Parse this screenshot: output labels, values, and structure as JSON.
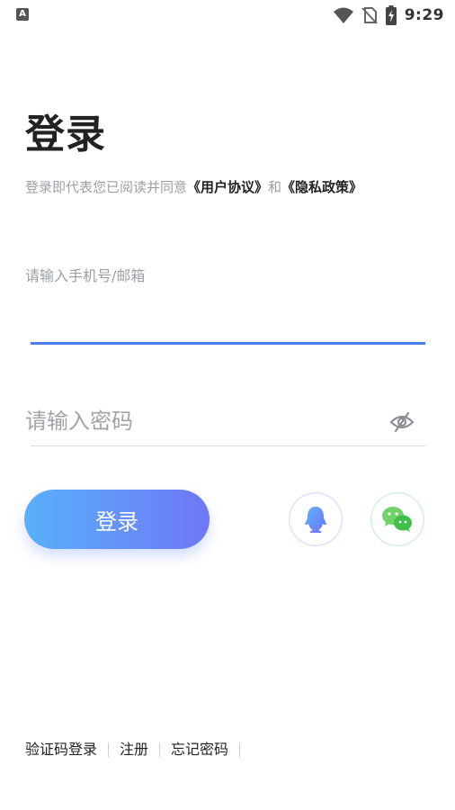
{
  "status_bar": {
    "left_icon_letter": "A",
    "time": "9:29",
    "icons": [
      "wifi-icon",
      "no-sim-icon",
      "battery-charging-icon"
    ]
  },
  "title": "登录",
  "agreement": {
    "prefix": "登录即代表您已阅读并同意",
    "user_agreement": "《用户协议》",
    "conjunction": "和",
    "privacy_policy": "《隐私政策》"
  },
  "phone": {
    "label": "请输入手机号/邮箱",
    "value": ""
  },
  "password": {
    "placeholder": "请输入密码",
    "value": "",
    "toggle_icon": "eye-hidden-icon"
  },
  "login_button": {
    "label": "登录"
  },
  "social": {
    "qq_icon": "qq-icon",
    "wechat_icon": "wechat-icon"
  },
  "bottom_links": {
    "sms_login": "验证码登录",
    "register": "注册",
    "forgot_password": "忘记密码"
  },
  "colors": {
    "accent": "#4a7ee8",
    "button_start": "#58b0fb",
    "button_end": "#6f77f6",
    "muted_text": "#9aa0a6"
  }
}
